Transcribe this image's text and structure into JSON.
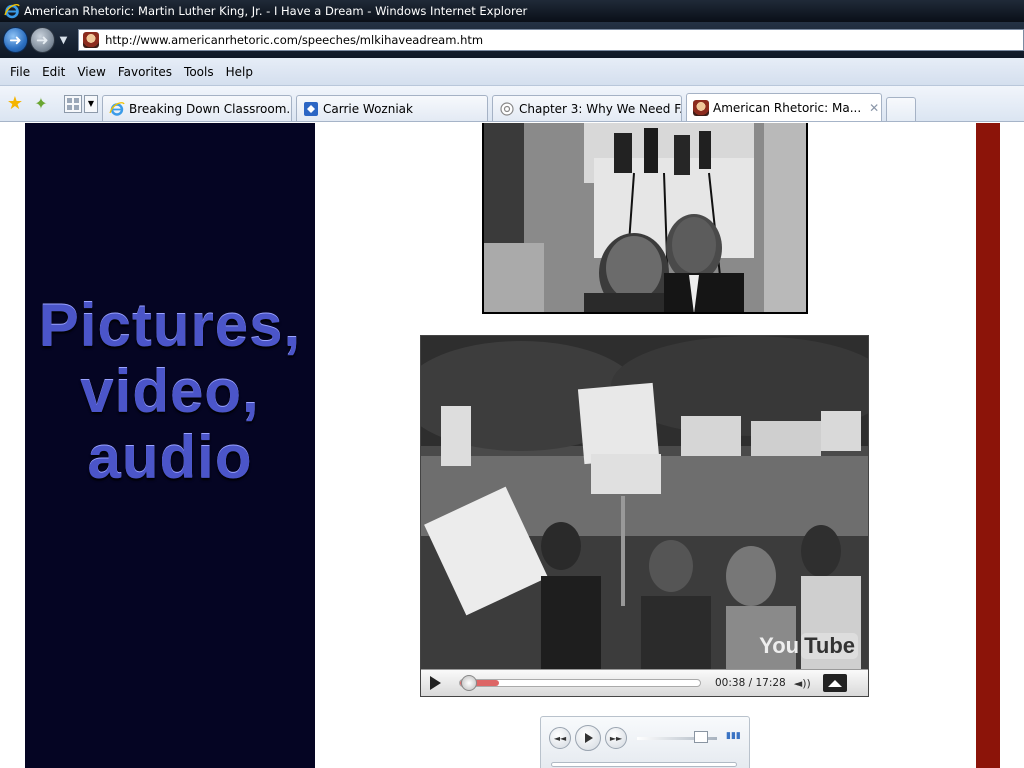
{
  "window": {
    "title": "American Rhetoric: Martin Luther King, Jr. - I Have a Dream - Windows Internet Explorer"
  },
  "address_bar": {
    "url": "http://www.americanrhetoric.com/speeches/mlkihaveadream.htm"
  },
  "menu": {
    "items": [
      "File",
      "Edit",
      "View",
      "Favorites",
      "Tools",
      "Help"
    ]
  },
  "tabs": [
    {
      "label": "Breaking Down Classroom...",
      "icon": "ie-page-icon",
      "active": false
    },
    {
      "label": "Carrie Wozniak",
      "icon": "blue-square-icon",
      "active": false
    },
    {
      "label": "Chapter 3: Why We Need F...",
      "icon": "circle-page-icon",
      "active": false
    },
    {
      "label": "American Rhetoric: Ma...",
      "icon": "americanrhetoric-favicon",
      "active": true
    }
  ],
  "page": {
    "side_heading": "Pictures, video, audio",
    "colors": {
      "left_panel": "#050523",
      "heading": "#4b55c9",
      "right_bar": "#8c1409"
    }
  },
  "video": {
    "time": "00:38 / 17:28",
    "progress": 0.036,
    "logo_you": "You",
    "logo_tube": "Tube"
  },
  "audio": {
    "volume": 0.8
  }
}
